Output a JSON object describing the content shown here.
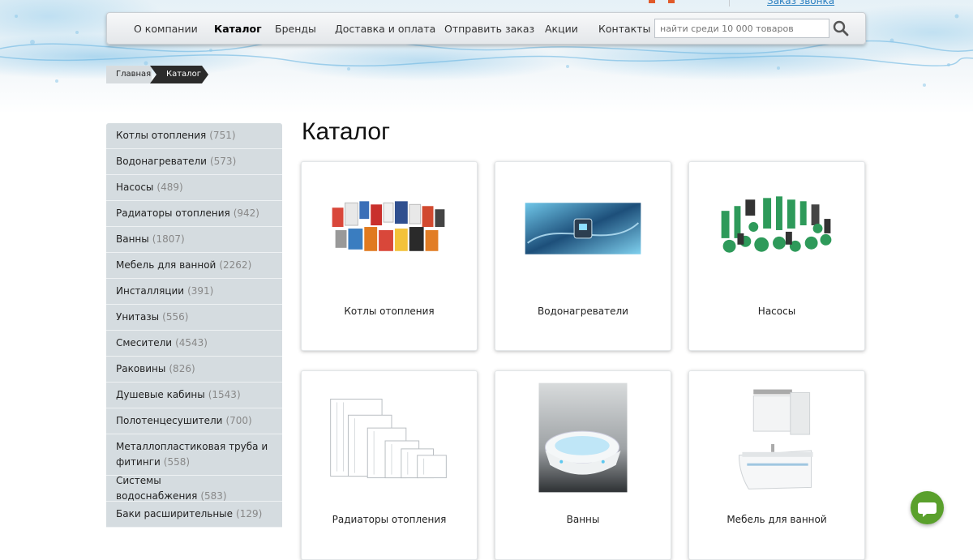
{
  "header": {
    "callback_link": "Заказ звонка"
  },
  "nav": {
    "items": [
      {
        "label": "О компании",
        "active": false
      },
      {
        "label": "Каталог",
        "active": true
      },
      {
        "label": "Бренды",
        "active": false
      },
      {
        "label": "Доставка и оплата",
        "active": false
      },
      {
        "label": "Отправить заказ",
        "active": false
      },
      {
        "label": "Акции",
        "active": false
      },
      {
        "label": "Контакты",
        "active": false
      }
    ],
    "search_placeholder": "найти среди 10 000 товаров",
    "search_icon": "search-icon"
  },
  "breadcrumb": {
    "home": "Главная",
    "current": "Каталог"
  },
  "sidebar": {
    "items": [
      {
        "label": "Котлы отопления",
        "count": "(751)"
      },
      {
        "label": "Водонагреватели",
        "count": "(573)"
      },
      {
        "label": "Насосы",
        "count": "(489)"
      },
      {
        "label": "Радиаторы отопления",
        "count": "(942)"
      },
      {
        "label": "Ванны",
        "count": "(1807)"
      },
      {
        "label": "Мебель для ванной",
        "count": "(2262)"
      },
      {
        "label": "Инсталляции",
        "count": "(391)"
      },
      {
        "label": "Унитазы",
        "count": "(556)"
      },
      {
        "label": "Смесители",
        "count": "(4543)"
      },
      {
        "label": "Раковины",
        "count": "(826)"
      },
      {
        "label": "Душевые кабины",
        "count": "(1543)"
      },
      {
        "label": "Полотенцесушители",
        "count": "(700)"
      },
      {
        "label": "Металлопластиковая труба и фитинги",
        "count": "(558)"
      },
      {
        "label": "Системы водоснабжения",
        "count": "(583)"
      },
      {
        "label": "Баки расширительные",
        "count": "(129)"
      }
    ]
  },
  "main": {
    "title": "Каталог",
    "cards": [
      {
        "label": "Котлы отопления"
      },
      {
        "label": "Водонагреватели"
      },
      {
        "label": "Насосы"
      },
      {
        "label": "Радиаторы отопления"
      },
      {
        "label": "Ванны"
      },
      {
        "label": "Мебель для ванной"
      }
    ]
  },
  "colors": {
    "accent_link": "#2a7fc0",
    "sidebar_bg": "#d5dce0",
    "breadcrumb_current_bg": "#2b2b2b",
    "chat_button": "#5aa02c",
    "pump_green": "#2e9a5a"
  },
  "chat": {
    "icon": "chat-bubble-icon"
  }
}
